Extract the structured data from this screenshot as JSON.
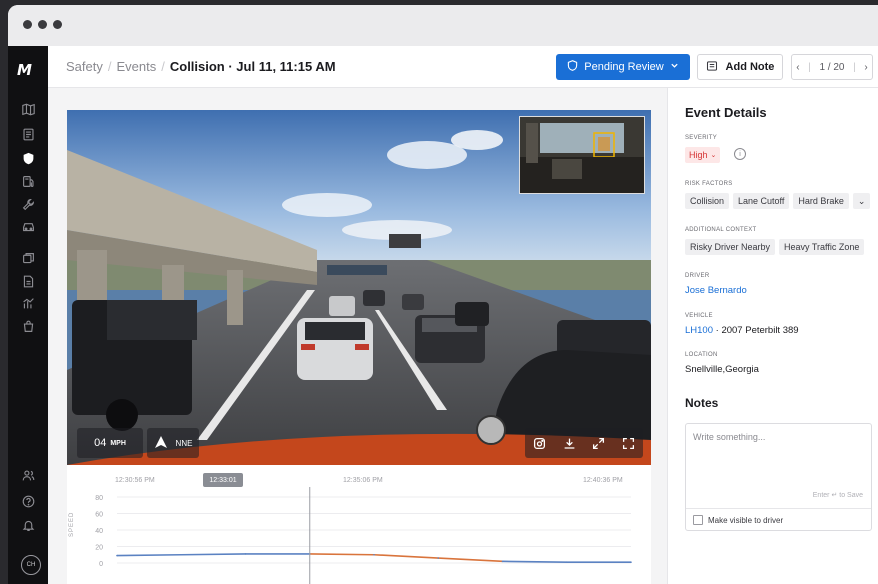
{
  "breadcrumb": {
    "items": [
      "Safety",
      "Events"
    ],
    "current": "Collision · Jul 11, 11:15 AM"
  },
  "toolbar": {
    "status_label": "Pending Review",
    "add_note_label": "Add Note",
    "pager": {
      "current": "1",
      "total": "20"
    }
  },
  "sidebar": {
    "logo": "M",
    "avatar_initials": "CH",
    "icons": [
      "map-icon",
      "document-icon",
      "shield-icon",
      "fuel-icon",
      "wrench-icon",
      "vehicle-icon",
      "layers-icon",
      "file-icon",
      "chart-icon",
      "bag-icon",
      "users-icon",
      "help-icon",
      "bell-icon"
    ]
  },
  "video": {
    "speed_value": "04",
    "speed_unit": "MPH",
    "heading": "NNE",
    "controls": [
      "snapshot-icon",
      "download-icon",
      "collapse-icon",
      "fullscreen-icon"
    ]
  },
  "timeline": {
    "times": [
      "12:30:56 PM",
      "12:35:06 PM",
      "12:40:36 PM"
    ],
    "current_time": "12:33:01",
    "y_label": "SPEED",
    "y_ticks": [
      "80",
      "60",
      "40",
      "20",
      "0"
    ]
  },
  "chart_data": {
    "type": "line",
    "ylabel": "SPEED",
    "ylim": [
      0,
      80
    ],
    "x": [
      "12:30:56 PM",
      "12:31:30 PM",
      "12:32:00 PM",
      "12:33:01 PM",
      "12:34:00 PM",
      "12:35:06 PM",
      "12:36:00 PM",
      "12:38:00 PM",
      "12:40:36 PM"
    ],
    "series": [
      {
        "values": [
          9,
          10,
          11,
          11,
          10,
          6,
          2,
          1,
          1
        ]
      }
    ],
    "marker_x": "12:33:01",
    "colors": [
      "#5b82c2",
      "#d9743c"
    ]
  },
  "details": {
    "title": "Event Details",
    "severity_label": "SEVERITY",
    "severity_value": "High",
    "risk_label": "RISK FACTORS",
    "risk_factors": [
      "Collision",
      "Lane Cutoff",
      "Hard Brake"
    ],
    "context_label": "ADDITIONAL CONTEXT",
    "context": [
      "Risky Driver Nearby",
      "Heavy Traffic Zone"
    ],
    "driver_label": "DRIVER",
    "driver": "Jose Bernardo",
    "vehicle_label": "VEHICLE",
    "vehicle_id": "LH100",
    "vehicle_model": "2007 Peterbilt 389",
    "location_label": "LOCATION",
    "location": "Snellville,Georgia"
  },
  "notes": {
    "title": "Notes",
    "placeholder": "Write something...",
    "hint": "Enter ↵ to Save",
    "visibility_label": "Make visible to driver"
  },
  "colors": {
    "accent": "#1a6fd6",
    "severity": "#d63636",
    "sidebar": "#101012"
  }
}
